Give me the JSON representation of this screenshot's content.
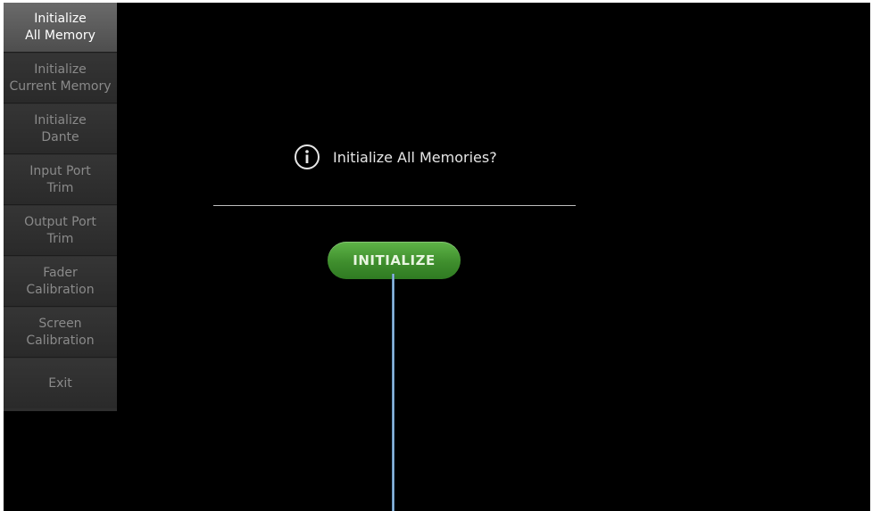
{
  "menu": {
    "items": [
      {
        "label": "Initialize\nAll Memory",
        "active": true
      },
      {
        "label": "Initialize\nCurrent Memory",
        "active": false
      },
      {
        "label": "Initialize\nDante",
        "active": false
      },
      {
        "label": "Input Port\nTrim",
        "active": false
      },
      {
        "label": "Output Port\nTrim",
        "active": false
      },
      {
        "label": "Fader\nCalibration",
        "active": false
      },
      {
        "label": "Screen\nCalibration",
        "active": false
      },
      {
        "label": "Exit",
        "active": false
      }
    ]
  },
  "dialog": {
    "icon": "info-icon",
    "message": "Initialize All Memories?",
    "button_label": "INITIALIZE"
  },
  "colors": {
    "button_green": "#3f8e2d",
    "active_menu": "#5c5c5c",
    "menu_bg": "#2f2f2f",
    "callout_line": "#9fc6e8"
  }
}
